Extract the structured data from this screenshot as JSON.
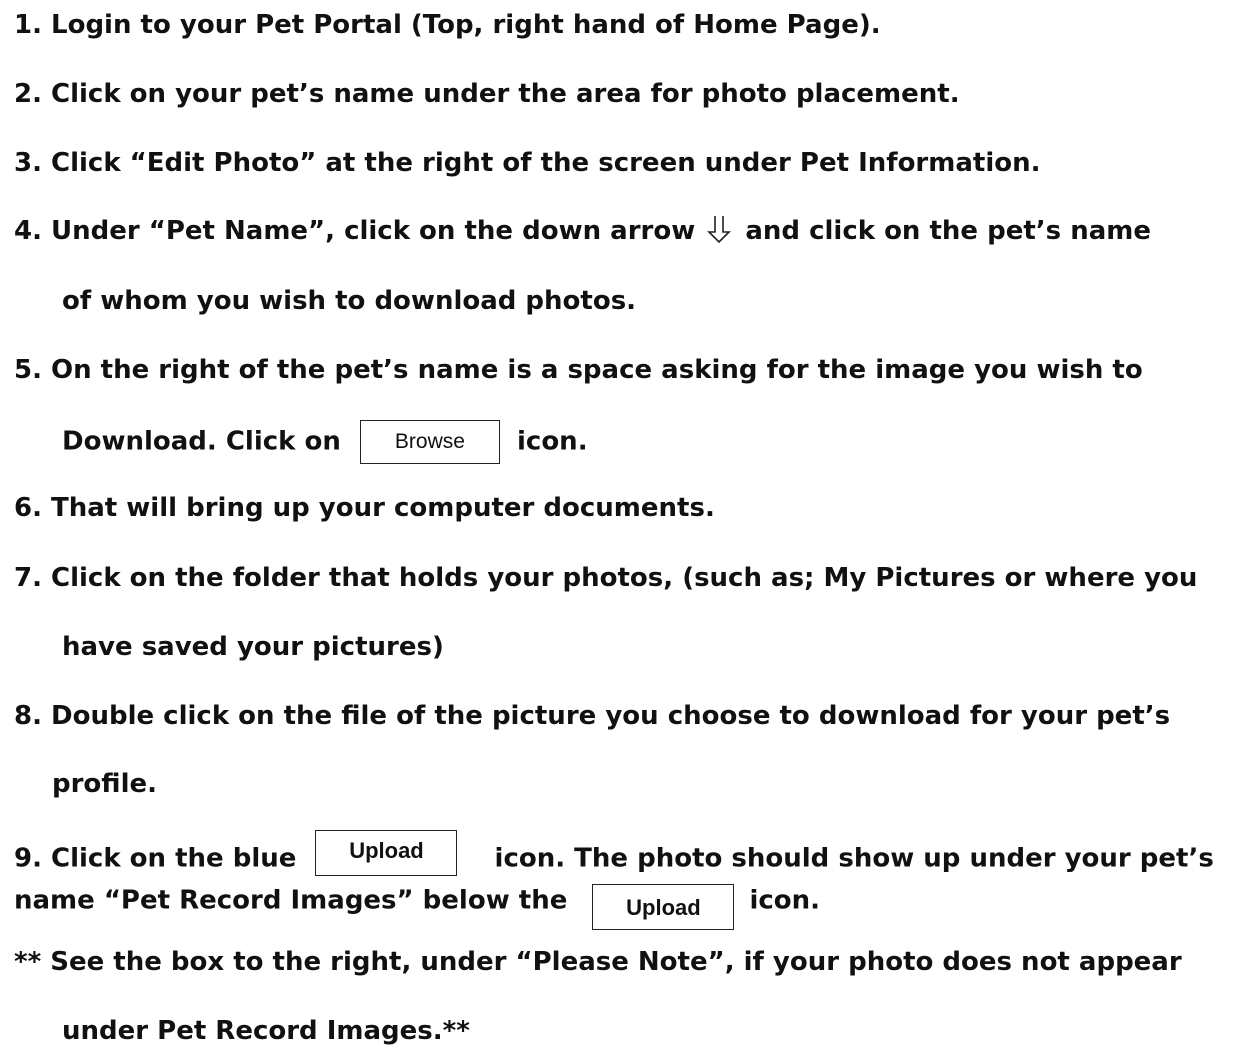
{
  "steps": {
    "s1": "1. Login to your Pet Portal (Top, right hand of Home Page).",
    "s2": "2. Click on your pet’s name under the area for photo placement.",
    "s3": "3. Click “Edit Photo” at the right of the screen under Pet Information.",
    "s4a": "4. Under “Pet Name”, click on the down arrow",
    "s4b": "and click on the pet’s name",
    "s4c": "of whom you wish to download photos.",
    "s5a": "5. On the right of the pet’s name is a space asking for the image you wish to",
    "s5b": "Download. Click on",
    "s5c": "icon.",
    "s6": "6. That will bring up your computer documents.",
    "s7a": "7. Click on the folder that holds your photos, (such as; My Pictures or where you",
    "s7b": "have saved your pictures)",
    "s8a": "8. Double click on the file of the picture you choose to download for your pet’s",
    "s8b": "profile.",
    "s9a": "9. Click on the blue",
    "s9b": "icon. The photo should show up under your pet’s",
    "s9c": "name “Pet Record Images” below the",
    "s9d": "icon.",
    "note_a": "** See the box to the right, under “Please Note”, if your photo does not appear",
    "note_b": "under Pet Record Images.**"
  },
  "buttons": {
    "browse": "Browse",
    "upload": "Upload"
  },
  "icons": {
    "down_arrow": "down-arrow-icon"
  }
}
